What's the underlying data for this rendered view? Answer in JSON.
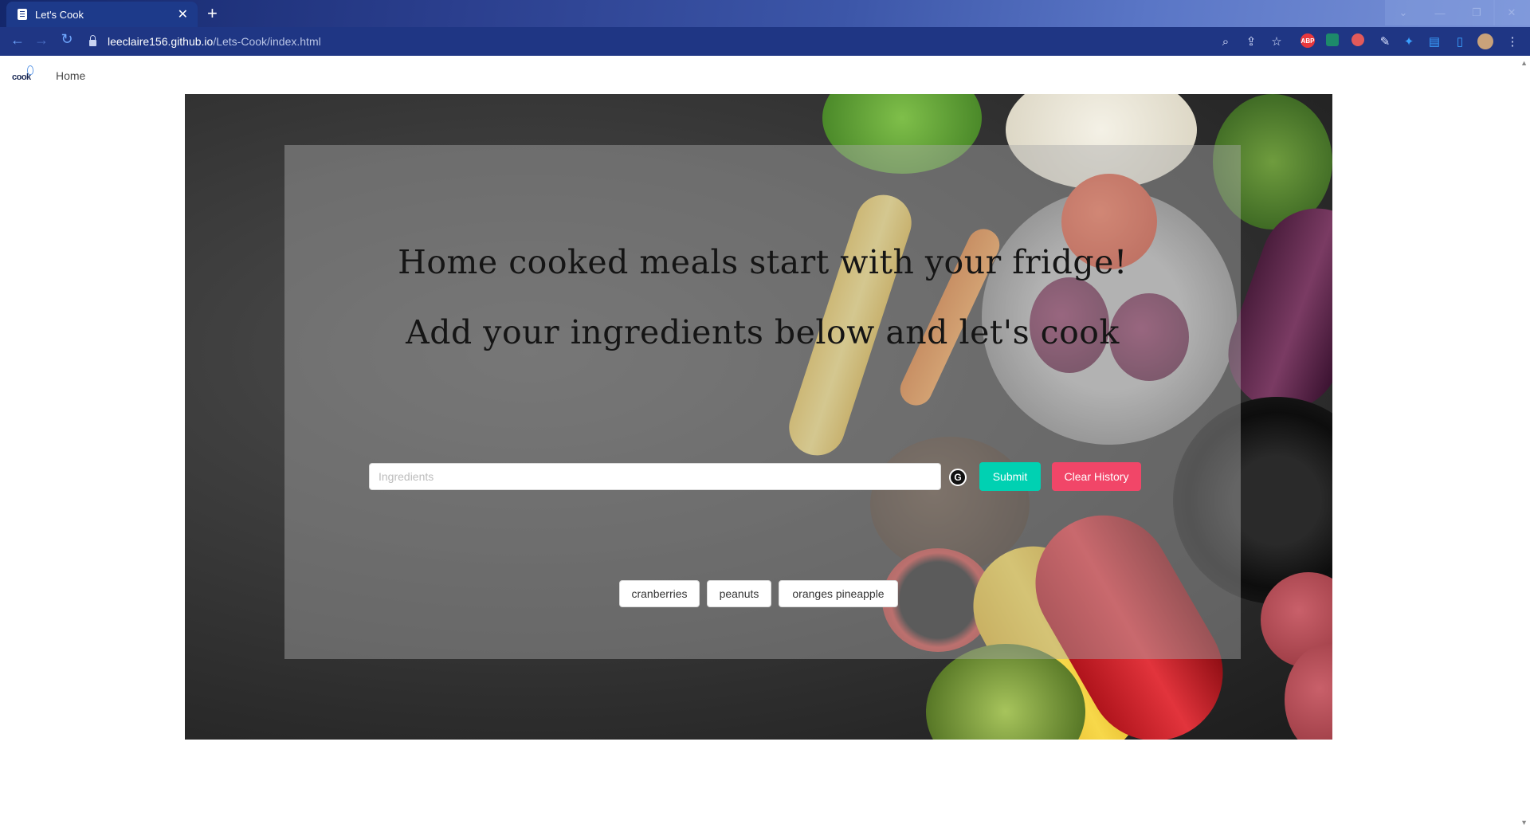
{
  "browser": {
    "tab_title": "Let's Cook",
    "tab_close": "✕",
    "new_tab": "+",
    "url_host": "leeclaire156.github.io",
    "url_path": "/Lets-Cook/index.html",
    "window_controls": [
      "⌄",
      "—",
      "❐",
      "✕"
    ],
    "extensions": [
      "ABP"
    ],
    "accent_color": "#1f3684"
  },
  "navbar": {
    "logo_text": "cook",
    "home_label": "Home"
  },
  "hero": {
    "headline_1": "Home cooked meals start with your fridge!",
    "headline_2": "Add your ingredients below and let's cook",
    "ingredients_placeholder": "Ingredients",
    "grammarly_icon": "G",
    "submit_label": "Submit",
    "clear_label": "Clear History",
    "submit_color": "#00d1b2",
    "clear_color": "#f14668",
    "history": [
      "cranberries",
      "peanuts",
      "oranges pineapple"
    ]
  }
}
